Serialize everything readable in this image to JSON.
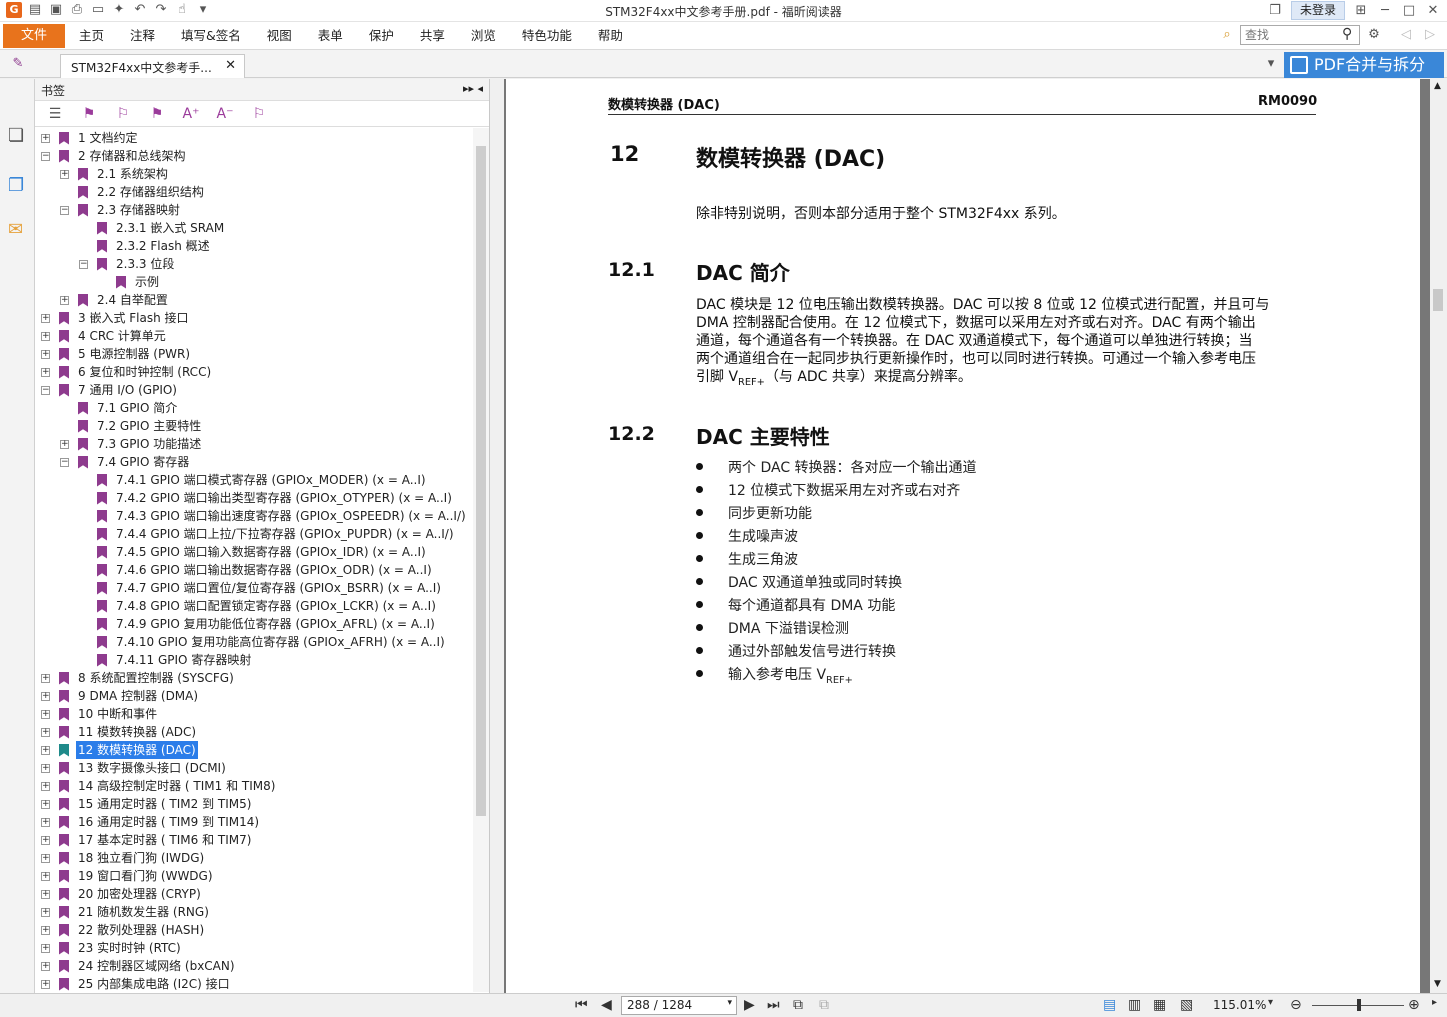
{
  "window": {
    "title": "STM32F4xx中文参考手册.pdf - 福昕阅读器",
    "login": "未登录"
  },
  "menu": {
    "file": "文件",
    "items": [
      "主页",
      "注释",
      "填写&签名",
      "视图",
      "表单",
      "保护",
      "共享",
      "浏览",
      "特色功能",
      "帮助"
    ],
    "search_placeholder": "查找"
  },
  "tab": {
    "name": "STM32F4xx中文参考手..."
  },
  "promo": {
    "label": "PDF合并与拆分"
  },
  "bookmarks": {
    "title": "书签",
    "items": [
      {
        "label": "1 文档约定",
        "level": 0,
        "toggle": "+"
      },
      {
        "label": "2 存储器和总线架构",
        "level": 0,
        "toggle": "-"
      },
      {
        "label": "2.1 系统架构",
        "level": 1,
        "toggle": "+"
      },
      {
        "label": "2.2 存储器组织结构",
        "level": 1,
        "toggle": ""
      },
      {
        "label": "2.3 存储器映射",
        "level": 1,
        "toggle": "-"
      },
      {
        "label": "2.3.1 嵌入式 SRAM",
        "level": 2,
        "toggle": ""
      },
      {
        "label": "2.3.2 Flash 概述",
        "level": 2,
        "toggle": ""
      },
      {
        "label": "2.3.3 位段",
        "level": 2,
        "toggle": "-"
      },
      {
        "label": "示例",
        "level": 3,
        "toggle": ""
      },
      {
        "label": "2.4 自举配置",
        "level": 1,
        "toggle": "+"
      },
      {
        "label": "3 嵌入式 Flash 接口",
        "level": 0,
        "toggle": "+"
      },
      {
        "label": "4 CRC 计算单元",
        "level": 0,
        "toggle": "+"
      },
      {
        "label": "5 电源控制器 (PWR)",
        "level": 0,
        "toggle": "+"
      },
      {
        "label": "6 复位和时钟控制 (RCC)",
        "level": 0,
        "toggle": "+"
      },
      {
        "label": "7 通用 I/O (GPIO)",
        "level": 0,
        "toggle": "-"
      },
      {
        "label": "7.1 GPIO 简介",
        "level": 1,
        "toggle": ""
      },
      {
        "label": "7.2 GPIO 主要特性",
        "level": 1,
        "toggle": ""
      },
      {
        "label": "7.3 GPIO 功能描述",
        "level": 1,
        "toggle": "+"
      },
      {
        "label": "7.4 GPIO 寄存器",
        "level": 1,
        "toggle": "-"
      },
      {
        "label": "7.4.1 GPIO 端口模式寄存器 (GPIOx_MODER) (x = A..I)",
        "level": 2,
        "toggle": ""
      },
      {
        "label": "7.4.2 GPIO 端口输出类型寄存器 (GPIOx_OTYPER) (x = A..I)",
        "level": 2,
        "toggle": ""
      },
      {
        "label": "7.4.3 GPIO 端口输出速度寄存器 (GPIOx_OSPEEDR) (x = A..I/)",
        "level": 2,
        "toggle": ""
      },
      {
        "label": "7.4.4 GPIO 端口上拉/下拉寄存器 (GPIOx_PUPDR) (x = A..I/)",
        "level": 2,
        "toggle": ""
      },
      {
        "label": "7.4.5 GPIO 端口输入数据寄存器 (GPIOx_IDR) (x = A..I)",
        "level": 2,
        "toggle": ""
      },
      {
        "label": "7.4.6 GPIO 端口输出数据寄存器 (GPIOx_ODR) (x = A..I)",
        "level": 2,
        "toggle": ""
      },
      {
        "label": "7.4.7 GPIO 端口置位/复位寄存器 (GPIOx_BSRR) (x = A..I)",
        "level": 2,
        "toggle": ""
      },
      {
        "label": "7.4.8 GPIO 端口配置锁定寄存器 (GPIOx_LCKR) (x = A..I)",
        "level": 2,
        "toggle": ""
      },
      {
        "label": "7.4.9 GPIO 复用功能低位寄存器 (GPIOx_AFRL) (x = A..I)",
        "level": 2,
        "toggle": ""
      },
      {
        "label": "7.4.10 GPIO 复用功能高位寄存器 (GPIOx_AFRH) (x = A..I)",
        "level": 2,
        "toggle": ""
      },
      {
        "label": "7.4.11 GPIO 寄存器映射",
        "level": 2,
        "toggle": ""
      },
      {
        "label": "8 系统配置控制器 (SYSCFG)",
        "level": 0,
        "toggle": "+"
      },
      {
        "label": "9 DMA 控制器 (DMA)",
        "level": 0,
        "toggle": "+"
      },
      {
        "label": "10 中断和事件",
        "level": 0,
        "toggle": "+"
      },
      {
        "label": "11 模数转换器 (ADC)",
        "level": 0,
        "toggle": "+"
      },
      {
        "label": "12 数模转换器 (DAC)",
        "level": 0,
        "toggle": "+",
        "selected": true
      },
      {
        "label": "13 数字摄像头接口 (DCMI)",
        "level": 0,
        "toggle": "+"
      },
      {
        "label": "14 高级控制定时器 ( TIM1 和 TIM8)",
        "level": 0,
        "toggle": "+"
      },
      {
        "label": "15 通用定时器 ( TIM2 到 TIM5)",
        "level": 0,
        "toggle": "+"
      },
      {
        "label": "16 通用定时器 ( TIM9 到 TIM14)",
        "level": 0,
        "toggle": "+"
      },
      {
        "label": "17 基本定时器 ( TIM6 和 TIM7)",
        "level": 0,
        "toggle": "+"
      },
      {
        "label": "18 独立看门狗 (IWDG)",
        "level": 0,
        "toggle": "+"
      },
      {
        "label": "19 窗口看门狗 (WWDG)",
        "level": 0,
        "toggle": "+"
      },
      {
        "label": "20 加密处理器 (CRYP)",
        "level": 0,
        "toggle": "+"
      },
      {
        "label": "21 随机数发生器 (RNG)",
        "level": 0,
        "toggle": "+"
      },
      {
        "label": "22 散列处理器 (HASH)",
        "level": 0,
        "toggle": "+"
      },
      {
        "label": "23 实时时钟 (RTC)",
        "level": 0,
        "toggle": "+"
      },
      {
        "label": "24 控制器区域网络 (bxCAN)",
        "level": 0,
        "toggle": "+"
      },
      {
        "label": "25 内部集成电路 (I2C) 接口",
        "level": 0,
        "toggle": "+"
      }
    ]
  },
  "pdf": {
    "header_left": "数模转换器 (DAC)",
    "header_right": "RM0090",
    "chapter_num": "12",
    "chapter_title": "数模转换器 (DAC)",
    "chapter_intro": "除非特别说明，否则本部分适用于整个 STM32F4xx 系列。",
    "s1_num": "12.1",
    "s1_title": "DAC 简介",
    "s1_lines": [
      "DAC 模块是 12 位电压输出数模转换器。DAC 可以按 8 位或 12 位模式进行配置，并且可与",
      "DMA 控制器配合使用。在 12 位模式下，数据可以采用左对齐或右对齐。DAC 有两个输出",
      "通道，每个通道各有一个转换器。在 DAC 双通道模式下，每个通道可以单独进行转换；当",
      "两个通道组合在一起同步执行更新操作时，也可以同时进行转换。可通过一个输入参考电压"
    ],
    "s1_last_pre": "引脚 V",
    "s1_last_sub": "REF+",
    "s1_last_post": "（与 ADC 共享）来提高分辨率。",
    "s2_num": "12.2",
    "s2_title": "DAC 主要特性",
    "bullets": [
      "两个 DAC 转换器：各对应一个输出通道",
      "12 位模式下数据采用左对齐或右对齐",
      "同步更新功能",
      "生成噪声波",
      "生成三角波",
      "DAC 双通道单独或同时转换",
      "每个通道都具有 DMA 功能",
      "DMA 下溢错误检测",
      "通过外部触发信号进行转换"
    ],
    "last_bullet_pre": "输入参考电压 V",
    "last_bullet_sub": "REF+"
  },
  "status": {
    "page": "288 / 1284",
    "zoom": "115.01%"
  }
}
